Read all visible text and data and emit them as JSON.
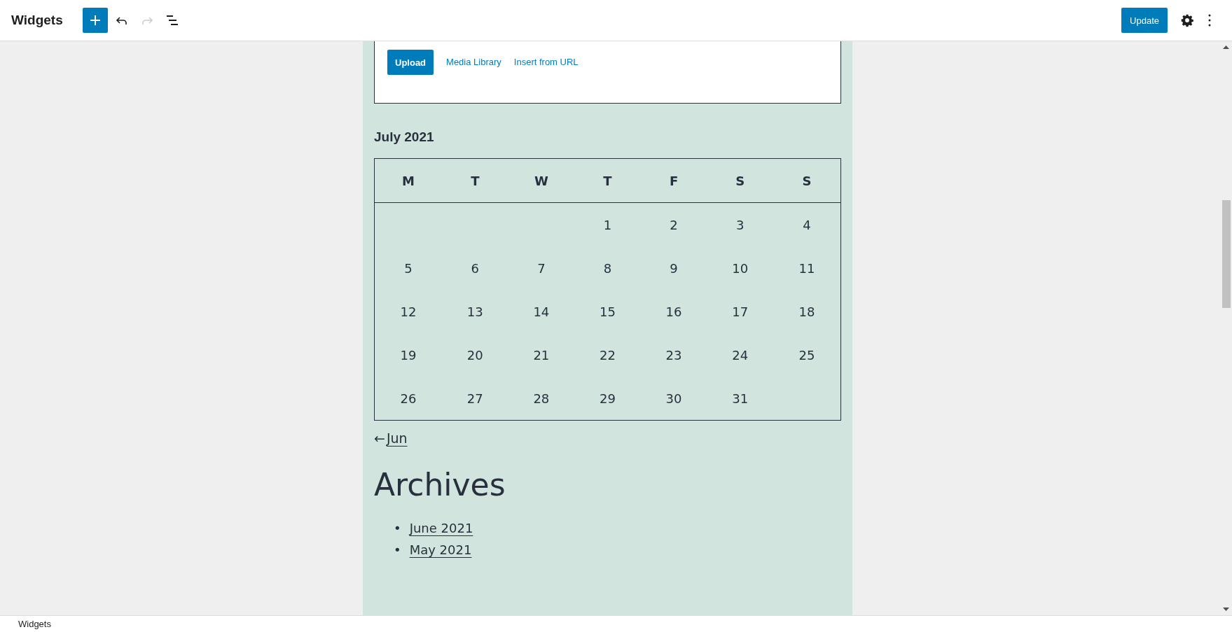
{
  "header": {
    "title": "Widgets",
    "tools": [
      {
        "kind": "add",
        "disabled": false
      },
      {
        "kind": "undo",
        "disabled": false
      },
      {
        "kind": "redo",
        "disabled": true
      },
      {
        "kind": "list-view",
        "disabled": false
      }
    ],
    "update": "Update",
    "actions": [
      {
        "kind": "settings"
      },
      {
        "kind": "more"
      }
    ]
  },
  "media": {
    "upload": "Upload",
    "links": [
      "Media Library",
      "Insert from URL"
    ]
  },
  "calendar": {
    "caption": "July 2021",
    "weekdays": [
      "M",
      "T",
      "W",
      "T",
      "F",
      "S",
      "S"
    ],
    "weeks": [
      {
        "kind": "first",
        "days": [
          "1",
          "2",
          "3",
          "4"
        ]
      },
      {
        "kind": "full",
        "days": [
          "5",
          "6",
          "7",
          "8",
          "9",
          "10",
          "11"
        ]
      },
      {
        "kind": "full",
        "days": [
          "12",
          "13",
          "14",
          "15",
          "16",
          "17",
          "18"
        ]
      },
      {
        "kind": "full",
        "days": [
          "19",
          "20",
          "21",
          "22",
          "23",
          "24",
          "25"
        ]
      },
      {
        "kind": "last",
        "days": [
          "26",
          "27",
          "28",
          "29",
          "30",
          "31"
        ]
      }
    ]
  },
  "calendar_nav": {
    "arrow": "←",
    "label": "Jun"
  },
  "archives": {
    "title": "Archives",
    "items": [
      {
        "marker": "•",
        "label": "June 2021"
      },
      {
        "marker": "•",
        "label": "May 2021"
      }
    ]
  },
  "footer": {
    "breadcrumb": "Widgets"
  }
}
